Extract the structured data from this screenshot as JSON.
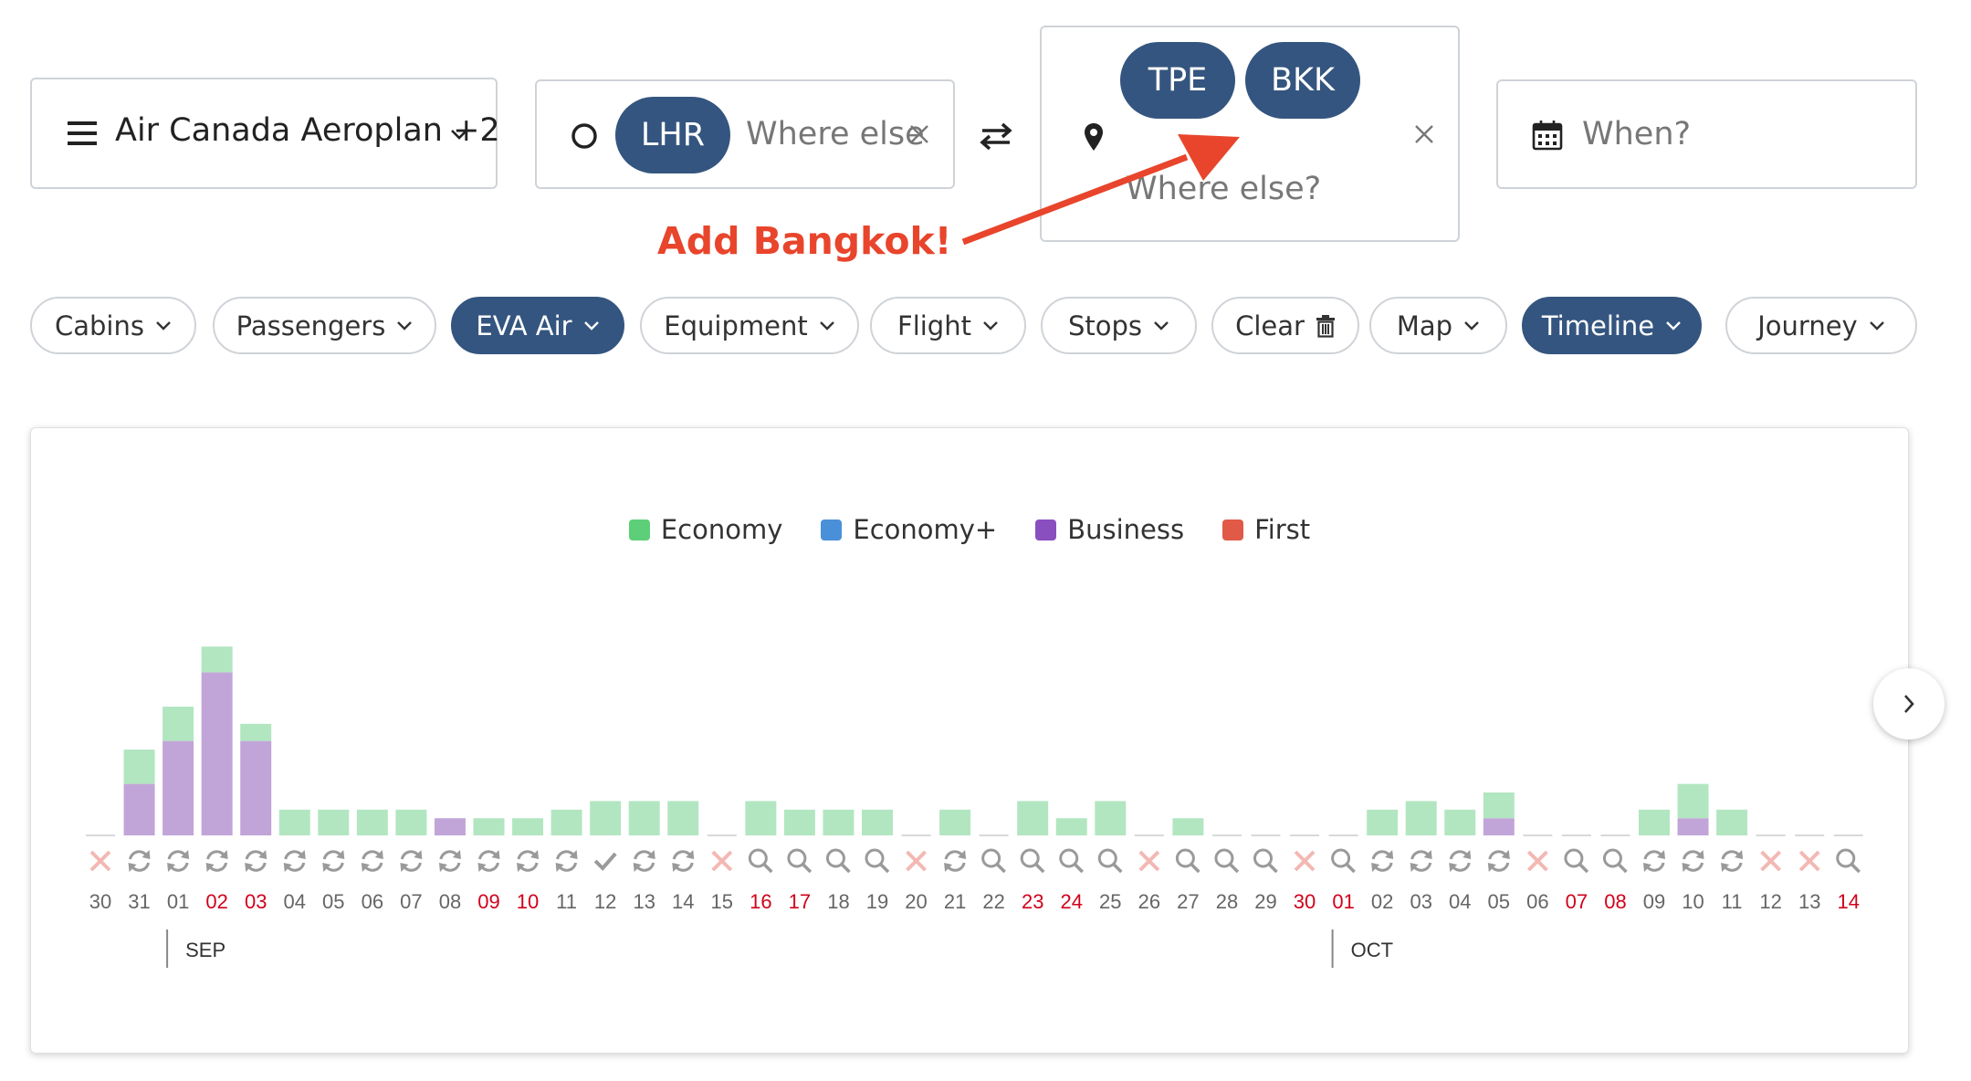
{
  "program_select": {
    "label": "Air Canada Aeroplan +2"
  },
  "origin": {
    "chips": [
      "LHR"
    ],
    "placeholder": "Where else"
  },
  "destination": {
    "chips": [
      "TPE",
      "BKK"
    ],
    "placeholder": "Where else?"
  },
  "when": {
    "placeholder": "When?"
  },
  "annotation": {
    "text": "Add Bangkok!"
  },
  "filters": [
    {
      "label": "Cabins",
      "active": false,
      "icon": "chevron-down-icon"
    },
    {
      "label": "Passengers",
      "active": false,
      "icon": "chevron-down-icon"
    },
    {
      "label": "EVA Air",
      "active": true,
      "icon": "chevron-down-icon"
    },
    {
      "label": "Equipment",
      "active": false,
      "icon": "chevron-down-icon"
    },
    {
      "label": "Flight",
      "active": false,
      "icon": "chevron-down-icon"
    },
    {
      "label": "Stops",
      "active": false,
      "icon": "chevron-down-icon"
    },
    {
      "label": "Clear",
      "active": false,
      "icon": "trash-icon"
    },
    {
      "label": "Map",
      "active": false,
      "icon": "chevron-down-icon"
    },
    {
      "label": "Timeline",
      "active": true,
      "icon": "chevron-down-icon"
    },
    {
      "label": "Journey",
      "active": false,
      "icon": "chevron-down-icon"
    }
  ],
  "colors": {
    "primary": "#34557f",
    "economy": "#5ccf78",
    "economy_plus": "#4a90d9",
    "business": "#8a4fbf",
    "first": "#e05a47",
    "weekend": "#d0021b",
    "annotation": "#e8452c"
  },
  "chart_data": {
    "type": "bar",
    "stacked": true,
    "legend": [
      "Economy",
      "Economy+",
      "Business",
      "First"
    ],
    "legend_colors": [
      "#5ccf78",
      "#4a90d9",
      "#8a4fbf",
      "#e05a47"
    ],
    "days": [
      "30",
      "31",
      "01",
      "02",
      "03",
      "04",
      "05",
      "06",
      "07",
      "08",
      "09",
      "10",
      "11",
      "12",
      "13",
      "14",
      "15",
      "16",
      "17",
      "18",
      "19",
      "20",
      "21",
      "22",
      "23",
      "24",
      "25",
      "26",
      "27",
      "28",
      "29",
      "30",
      "01",
      "02",
      "03",
      "04",
      "05",
      "06",
      "07",
      "08",
      "09",
      "10",
      "11",
      "12",
      "13",
      "14"
    ],
    "weekend": [
      false,
      false,
      false,
      true,
      true,
      false,
      false,
      false,
      false,
      false,
      true,
      true,
      false,
      false,
      false,
      false,
      false,
      true,
      true,
      false,
      false,
      false,
      false,
      false,
      true,
      true,
      false,
      false,
      false,
      false,
      false,
      true,
      true,
      false,
      false,
      false,
      false,
      false,
      true,
      true,
      false,
      false,
      false,
      false,
      false,
      true
    ],
    "status": [
      "x",
      "refresh",
      "refresh",
      "refresh",
      "refresh",
      "refresh",
      "refresh",
      "refresh",
      "refresh",
      "refresh",
      "refresh",
      "refresh",
      "refresh",
      "check",
      "refresh",
      "refresh",
      "x",
      "search",
      "search",
      "search",
      "search",
      "x",
      "refresh",
      "search",
      "search",
      "search",
      "search",
      "x",
      "search",
      "search",
      "search",
      "x",
      "search",
      "refresh",
      "refresh",
      "refresh",
      "refresh",
      "x",
      "search",
      "search",
      "refresh",
      "refresh",
      "refresh",
      "x",
      "x",
      "search"
    ],
    "series": [
      {
        "name": "Economy",
        "values": [
          0,
          4,
          4,
          3,
          2,
          3,
          3,
          3,
          3,
          0,
          2,
          2,
          3,
          4,
          4,
          4,
          0,
          4,
          3,
          3,
          3,
          0,
          3,
          0,
          4,
          2,
          4,
          0,
          2,
          0,
          0,
          0,
          0,
          3,
          4,
          3,
          3,
          0,
          0,
          0,
          3,
          4,
          3,
          0,
          0,
          0
        ]
      },
      {
        "name": "Economy+",
        "values": [
          0,
          0,
          0,
          0,
          0,
          0,
          0,
          0,
          0,
          0,
          0,
          0,
          0,
          0,
          0,
          0,
          0,
          0,
          0,
          0,
          0,
          0,
          0,
          0,
          0,
          0,
          0,
          0,
          0,
          0,
          0,
          0,
          0,
          0,
          0,
          0,
          0,
          0,
          0,
          0,
          0,
          0,
          0,
          0,
          0,
          0
        ]
      },
      {
        "name": "Business",
        "values": [
          0,
          6,
          11,
          19,
          11,
          0,
          0,
          0,
          0,
          2,
          0,
          0,
          0,
          0,
          0,
          0,
          0,
          0,
          0,
          0,
          0,
          0,
          0,
          0,
          0,
          0,
          0,
          0,
          0,
          0,
          0,
          0,
          0,
          0,
          0,
          0,
          2,
          0,
          0,
          0,
          0,
          2,
          0,
          0,
          0,
          0
        ]
      },
      {
        "name": "First",
        "values": [
          0,
          0,
          0,
          0,
          0,
          0,
          0,
          0,
          0,
          0,
          0,
          0,
          0,
          0,
          0,
          0,
          0,
          0,
          0,
          0,
          0,
          0,
          0,
          0,
          0,
          0,
          0,
          0,
          0,
          0,
          0,
          0,
          0,
          0,
          0,
          0,
          0,
          0,
          0,
          0,
          0,
          0,
          0,
          0,
          0,
          0
        ]
      }
    ],
    "months": [
      {
        "label": "SEP",
        "start_index": 2
      },
      {
        "label": "OCT",
        "start_index": 32
      }
    ]
  }
}
